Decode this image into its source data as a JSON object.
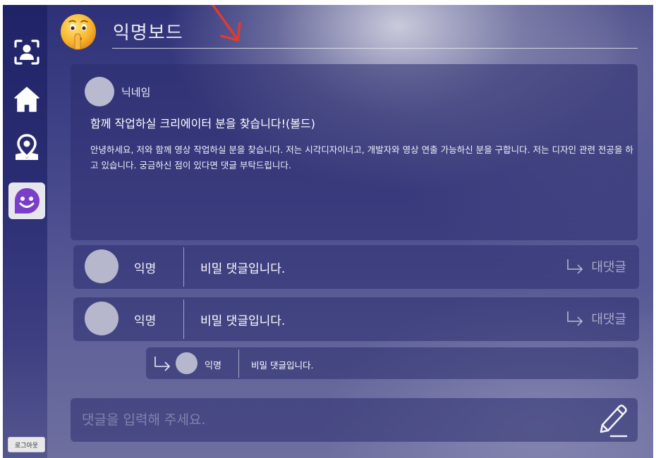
{
  "sidebar": {
    "items": [
      {
        "icon": "profile-scan-icon"
      },
      {
        "icon": "home-icon"
      },
      {
        "icon": "map-pin-icon"
      },
      {
        "icon": "smile-chat-icon",
        "active": true
      }
    ],
    "logout_label": "로그아웃"
  },
  "header": {
    "title": "익명보드",
    "emoji": "shushing-face-emoji"
  },
  "post": {
    "nickname": "닉네임",
    "title": "함께 작업하실 크리에이터 분을 찾습니다!(볼드)",
    "body": "안녕하세요, 저와 함께 영상 작업하실 분을 찾습니다.  저는 시각디자이너고, 개발자와 영상 연출 가능하신 분을 구합니다. 저는 디자인 관련 전공을 하고 있습니다. 궁금하신 점이 있다면 댓글 부탁드립니다."
  },
  "comments": [
    {
      "name": "익명",
      "text": "비밀 댓글입니다.",
      "reply_label": "대댓글"
    },
    {
      "name": "익명",
      "text": "비밀 댓글입니다.",
      "reply_label": "대댓글"
    }
  ],
  "replies": [
    {
      "name": "익명",
      "text": "비밀 댓글입니다."
    }
  ],
  "comment_input": {
    "placeholder": "댓글을 입력해 주세요.",
    "value": ""
  },
  "colors": {
    "accent": "#7a3fc8",
    "annotation_arrow": "#e23a2e",
    "background_dark": "#2f3178"
  }
}
